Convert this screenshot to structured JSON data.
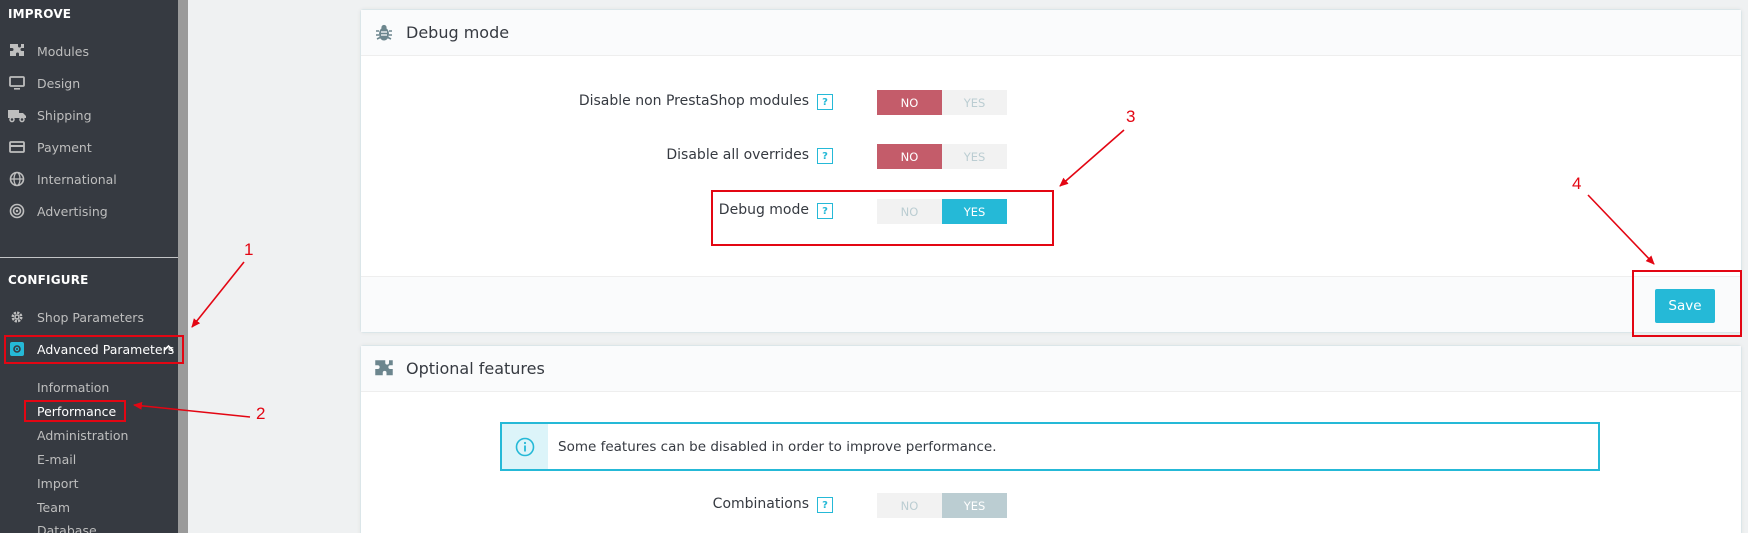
{
  "sidebar": {
    "improve_title": "IMPROVE",
    "improve_items": [
      {
        "label": "Modules",
        "icon": "puzzle-icon"
      },
      {
        "label": "Design",
        "icon": "desktop-icon"
      },
      {
        "label": "Shipping",
        "icon": "truck-icon"
      },
      {
        "label": "Payment",
        "icon": "credit-card-icon"
      },
      {
        "label": "International",
        "icon": "globe-icon"
      },
      {
        "label": "Advertising",
        "icon": "target-icon"
      }
    ],
    "configure_title": "CONFIGURE",
    "configure_items": [
      {
        "label": "Shop Parameters",
        "icon": "gear-icon"
      },
      {
        "label": "Advanced Parameters",
        "icon": "settings-box-icon"
      }
    ],
    "sub_items": [
      "Information",
      "Performance",
      "Administration",
      "E-mail",
      "Import",
      "Team",
      "Database"
    ],
    "active_sub": "Performance"
  },
  "debug_panel": {
    "title": "Debug mode",
    "icon": "bug-icon",
    "rows": [
      {
        "label": "Disable non PrestaShop modules",
        "help": "?",
        "no": "NO",
        "yes": "YES",
        "value": "NO"
      },
      {
        "label": "Disable all overrides",
        "help": "?",
        "no": "NO",
        "yes": "YES",
        "value": "NO"
      },
      {
        "label": "Debug mode",
        "help": "?",
        "no": "NO",
        "yes": "YES",
        "value": "YES"
      }
    ],
    "save_label": "Save"
  },
  "optional_panel": {
    "title": "Optional features",
    "icon": "puzzle-icon",
    "info_text": "Some features can be disabled in order to improve performance.",
    "info_icon": "info-icon",
    "rows": [
      {
        "label": "Combinations",
        "help": "?",
        "no": "NO",
        "yes": "YES",
        "value": "YES"
      }
    ]
  },
  "annotations": [
    "1",
    "2",
    "3",
    "4"
  ],
  "colors": {
    "accent": "#25b9d7",
    "danger": "#c45c6a",
    "sidebar_bg": "#363a41",
    "annotation_red": "#e30613"
  }
}
